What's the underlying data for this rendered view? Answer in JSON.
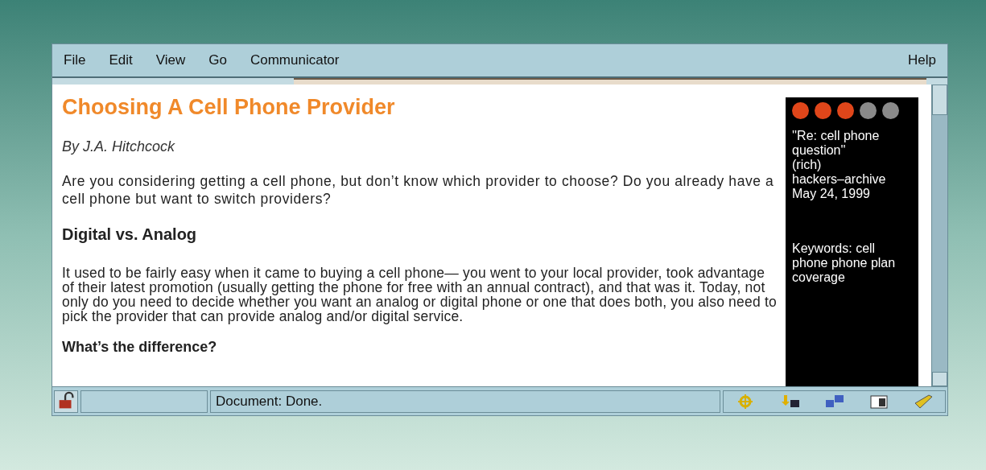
{
  "menu": [
    "File",
    "Edit",
    "View",
    "Go",
    "Communicator"
  ],
  "help_menu": "Help",
  "article": {
    "title": "Choosing A Cell Phone Provider",
    "byline": "By J.A. Hitchcock",
    "intro": "Are you considering getting a cell phone, but don’t know which provider to choose? Do you already have a cell phone but want to switch providers?",
    "heading": "Digital vs. Analog",
    "body": "It used to be fairly easy when it came to buying a cell phone— you went to your local provider, took advantage of their latest promotion (usually getting the phone for free with an annual contract), and that was it. Today, not only do you need to decide whether you want an analog or digital phone or one that does both, you also need to pick the provider that can provide analog and/or digital service.",
    "subheading": "What’s the difference?"
  },
  "sidebar": {
    "stars": 3,
    "lines": [
      "''Re: cell phone question''",
      "(rich)",
      "hackers–archive",
      "May 24, 1999"
    ],
    "keywords": "Keywords: cell phone phone plan coverage"
  },
  "status_bar": {
    "status": "Document: Done."
  }
}
